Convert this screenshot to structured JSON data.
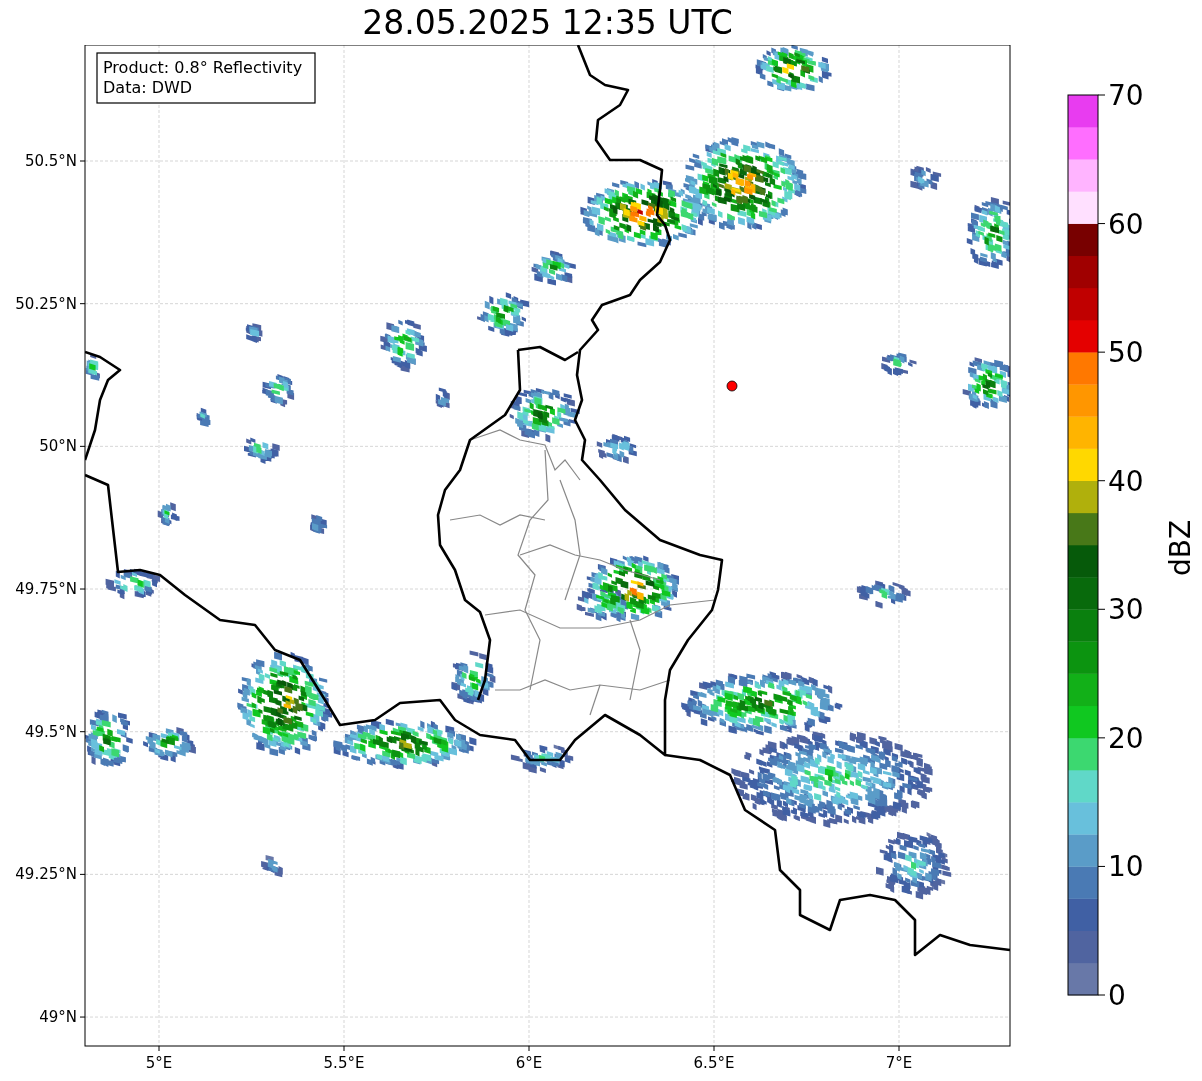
{
  "title": "28.05.2025 12:35 UTC",
  "info_box": {
    "lines": [
      "Product: 0.8° Reflectivity",
      "Data: DWD"
    ]
  },
  "map": {
    "x_tick_labels": [
      "5°E",
      "5.5°E",
      "6°E",
      "6.5°E",
      "7°E"
    ],
    "y_tick_labels": [
      "50.5°N",
      "50.25°N",
      "50°N",
      "49.75°N",
      "49.5°N",
      "49.25°N",
      "49°N"
    ]
  },
  "colorbar": {
    "label": "dBZ",
    "tick_labels": [
      "70",
      "60",
      "50",
      "40",
      "30",
      "20",
      "10",
      "0"
    ],
    "bins": [
      {
        "color": "#6878a8"
      },
      {
        "color": "#5064a0"
      },
      {
        "color": "#4060a4"
      },
      {
        "color": "#4a7ab4"
      },
      {
        "color": "#5a9cc8"
      },
      {
        "color": "#68c0dc"
      },
      {
        "color": "#60d8c8"
      },
      {
        "color": "#3cd870"
      },
      {
        "color": "#10c820"
      },
      {
        "color": "#12b018"
      },
      {
        "color": "#0c9410"
      },
      {
        "color": "#0a800e"
      },
      {
        "color": "#086a0c"
      },
      {
        "color": "#065a0a"
      },
      {
        "color": "#487818"
      },
      {
        "color": "#b0b00c"
      },
      {
        "color": "#ffd800"
      },
      {
        "color": "#ffb400"
      },
      {
        "color": "#ff9600"
      },
      {
        "color": "#ff7800"
      },
      {
        "color": "#e40000"
      },
      {
        "color": "#c00000"
      },
      {
        "color": "#a00000"
      },
      {
        "color": "#780000"
      },
      {
        "color": "#ffe0ff"
      },
      {
        "color": "#ffb4ff"
      },
      {
        "color": "#ff6eff"
      },
      {
        "color": "#e83cf0"
      }
    ]
  }
}
